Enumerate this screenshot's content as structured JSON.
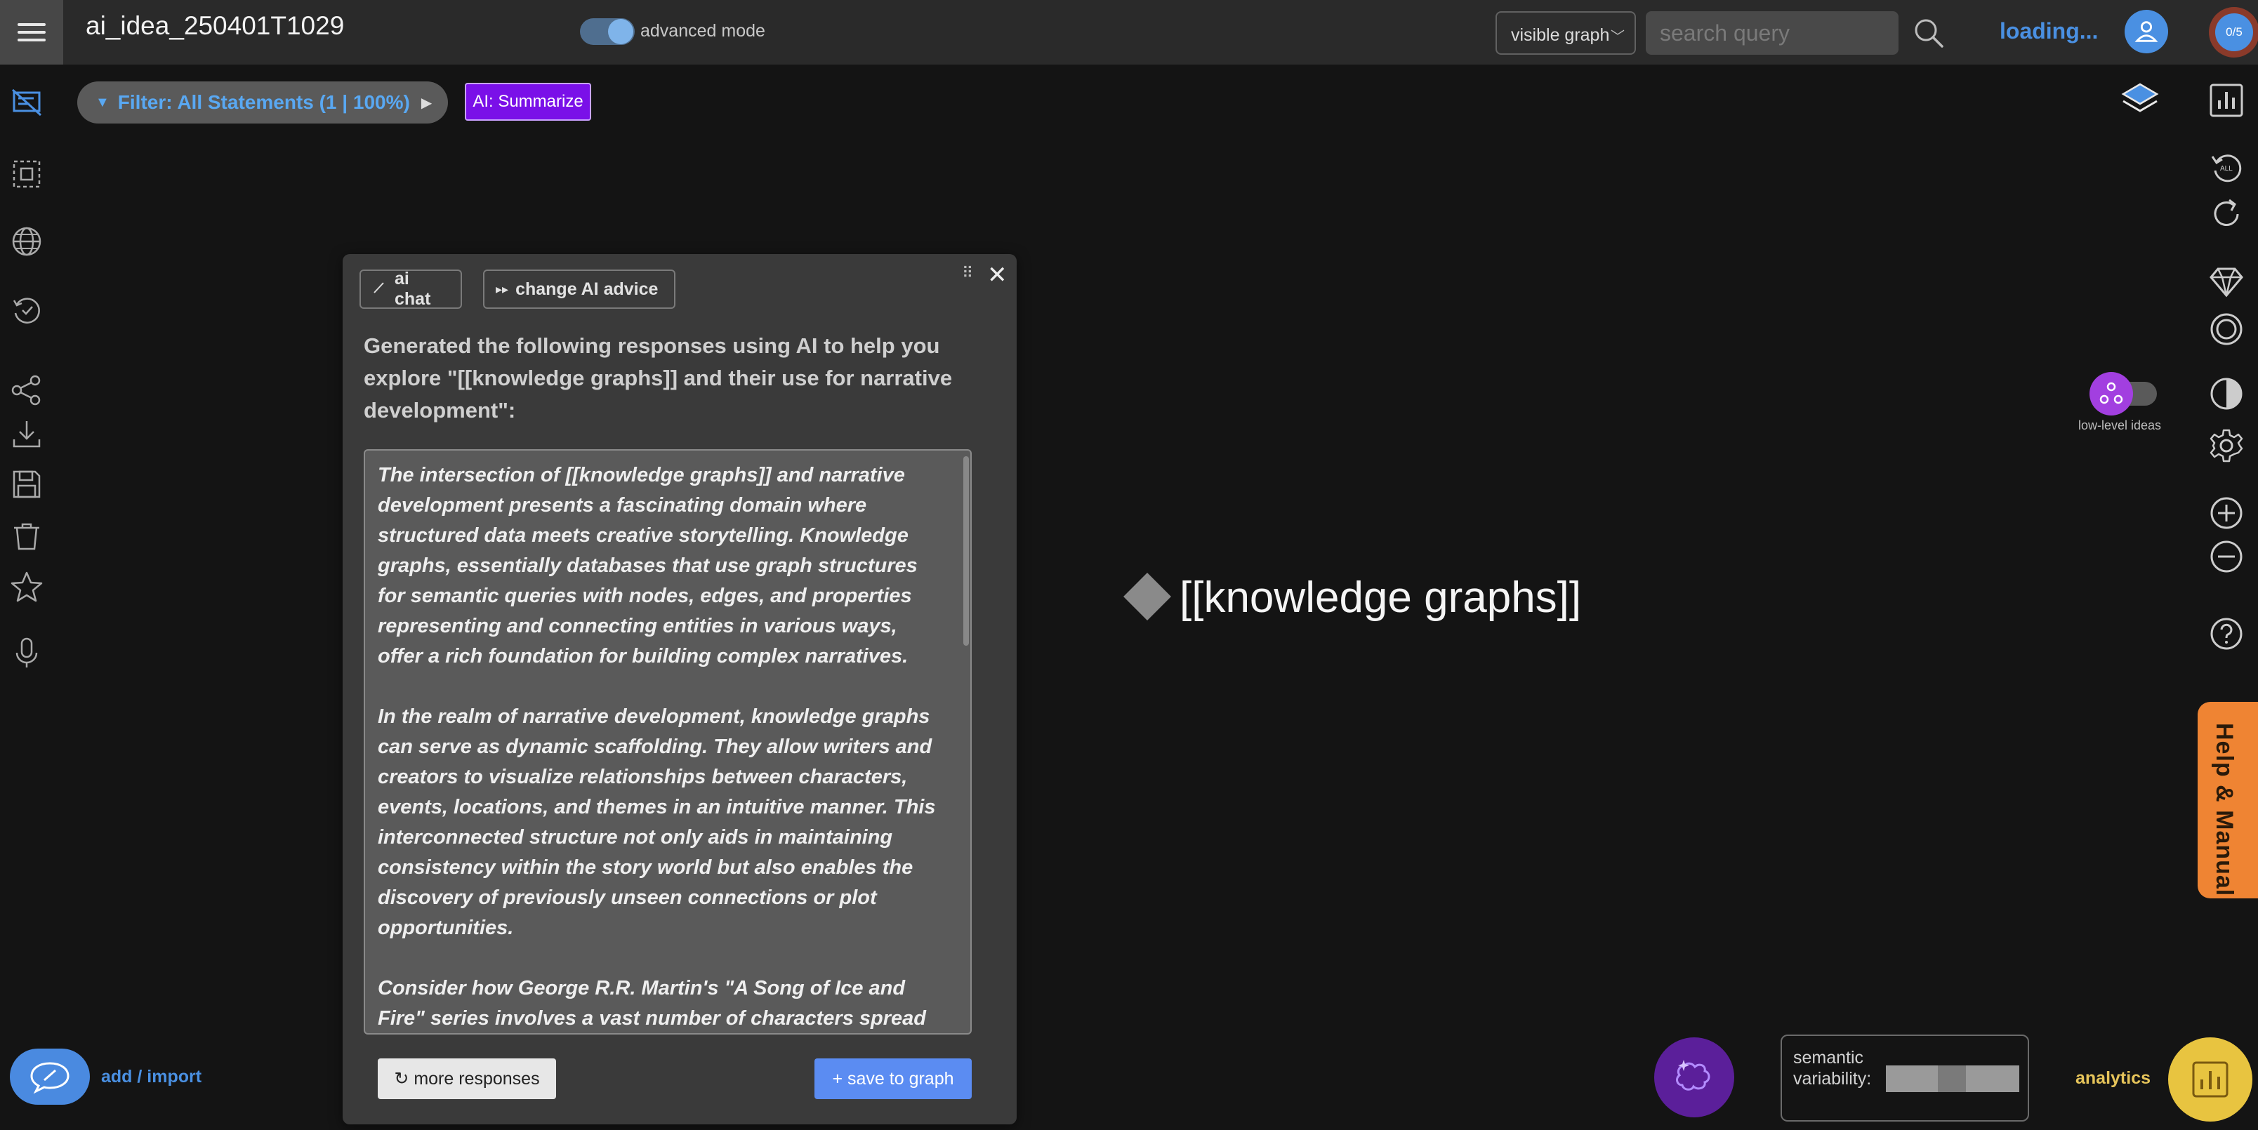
{
  "header": {
    "app_title": "ai_idea_250401T1029",
    "advanced_mode_label": "advanced mode",
    "advanced_mode_on": true,
    "view_select_value": "visible graph",
    "search_placeholder": "search query",
    "status_text": "loading...",
    "counter_badge": "0/5"
  },
  "toolbar": {
    "filter_label": "Filter: All Statements (1 | 100%)",
    "ai_summarize_label": "AI: Summarize"
  },
  "ai_panel": {
    "tab_ai_chat": "ai chat",
    "tab_change_advice": "change AI advice",
    "intro": "Generated the following responses using AI to help you explore \"[[knowledge graphs]] and their use for narrative development\":",
    "paragraphs": [
      "The intersection of [[knowledge graphs]] and narrative development presents a fascinating domain where structured data meets creative storytelling. Knowledge graphs, essentially databases that use graph structures for semantic queries with nodes, edges, and properties representing and connecting entities in various ways, offer a rich foundation for building complex narratives.",
      "In the realm of narrative development, knowledge graphs can serve as dynamic scaffolding. They allow writers and creators to visualize relationships between characters, events, locations, and themes in an intuitive manner. This interconnected structure not only aids in maintaining consistency within the story world but also enables the discovery of previously unseen connections or plot opportunities.",
      "Consider how George R.R. Martin's \"A Song of Ice and Fire\" series involves a vast number of characters spread"
    ],
    "more_responses_label": "↻ more responses",
    "save_label": "+ save to graph"
  },
  "graph": {
    "node_label": "[[knowledge graphs]]"
  },
  "right_panel": {
    "low_level_ideas_label": "low-level ideas",
    "help_label": "Help & Manual"
  },
  "bottom": {
    "add_import_label": "add / import",
    "semantic_variability_label": "semantic variability:",
    "analytics_label": "analytics"
  },
  "colors": {
    "accent_blue": "#4a90e2",
    "ai_purple": "#7a10e8",
    "help_orange": "#ef8433",
    "analytics_gold": "#e8c440"
  }
}
